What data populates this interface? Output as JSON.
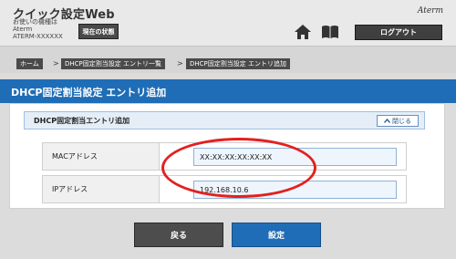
{
  "header": {
    "app_title": "クイック設定Web",
    "device_caption": "お使いの機種は",
    "device_name": "Aterm",
    "device_id": "ATERM-XXXXXX",
    "status_button": "現在の状態",
    "brand_logo": "Aterm",
    "logout_button": "ログアウト",
    "icons": [
      "home-icon",
      "book-icon"
    ]
  },
  "breadcrumb": {
    "items": [
      {
        "label": "ホーム"
      },
      {
        "label": "DHCP固定割当設定 エントリ一覧"
      },
      {
        "label": "DHCP固定割当設定 エントリ追加"
      }
    ],
    "separator": ">"
  },
  "page": {
    "title": "DHCP固定割当設定 エントリ追加"
  },
  "section": {
    "title": "DHCP固定割当エントリ追加",
    "collapse_button": "閉じる",
    "collapse_icon": "chevron-up-icon"
  },
  "form": {
    "rows": [
      {
        "label": "MACアドレス",
        "value": "XX:XX:XX:XX:XX:XX"
      },
      {
        "label": "IPアドレス",
        "value": "192.168.10.6"
      }
    ]
  },
  "actions": {
    "back_label": "戻る",
    "submit_label": "設定"
  },
  "colors": {
    "accent": "#1f6db6",
    "highlight": "#e32020",
    "dark_button": "#4d4d4d"
  }
}
